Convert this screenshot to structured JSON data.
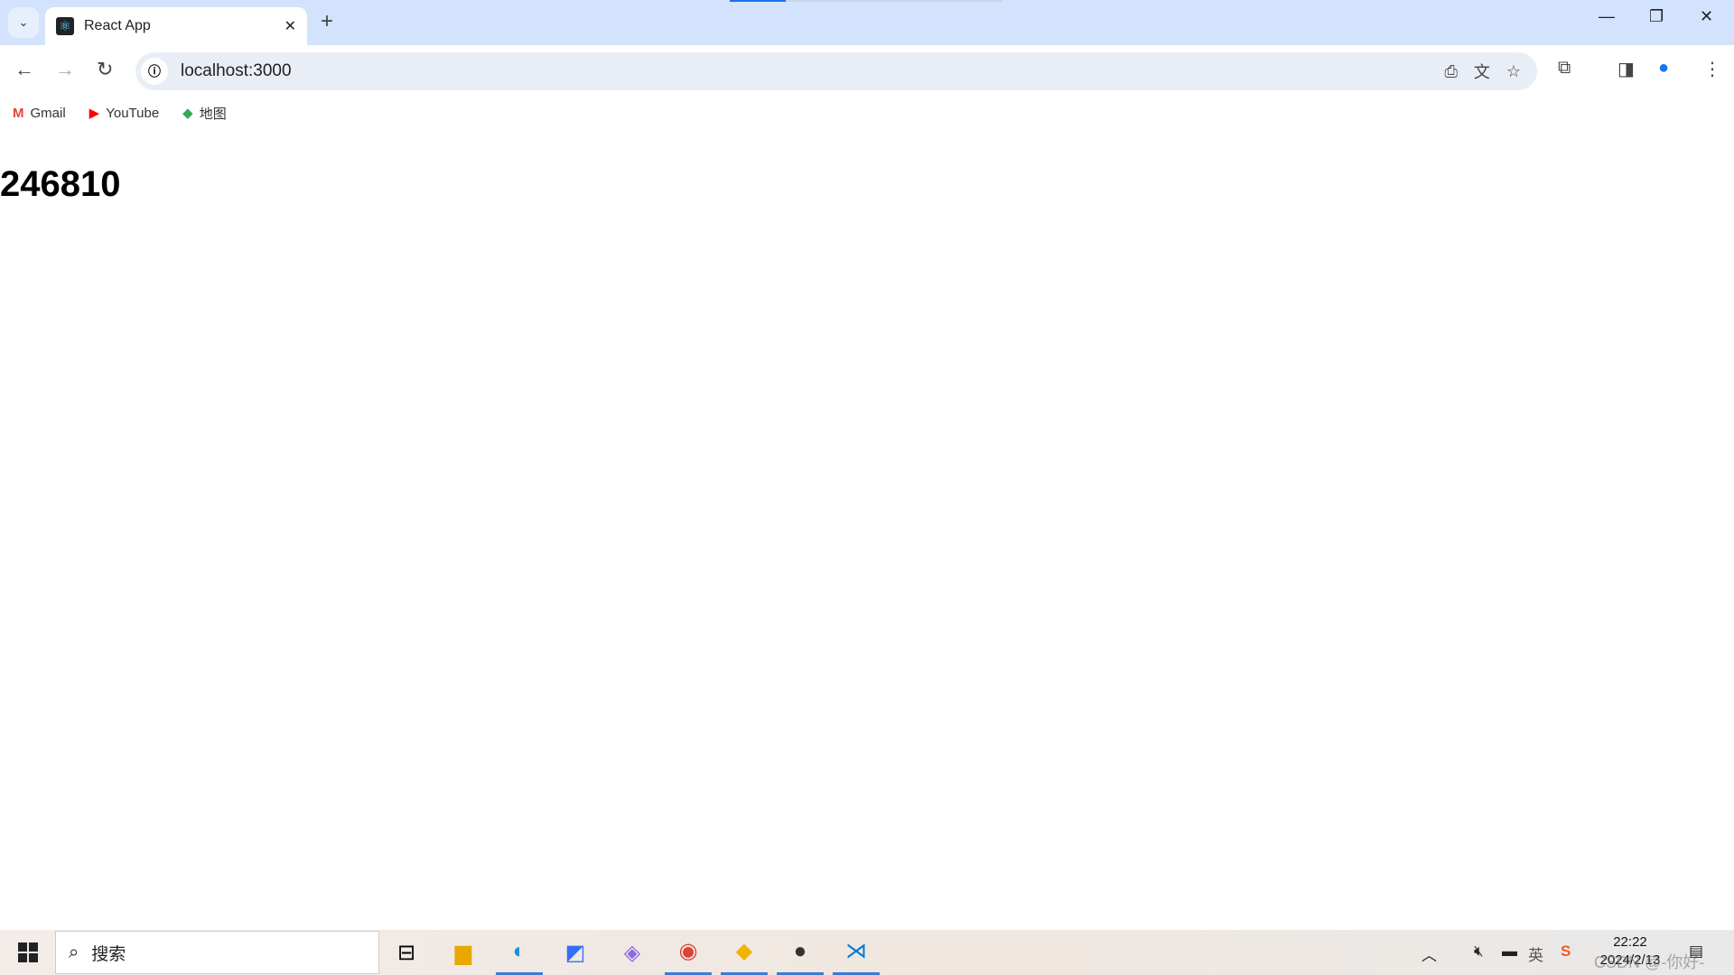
{
  "browser": {
    "tab": {
      "title": "React App",
      "favicon": "react-logo-icon"
    },
    "address": "localhost:3000",
    "bookmarks": [
      {
        "label": "Gmail",
        "icon": "gmail-icon"
      },
      {
        "label": "YouTube",
        "icon": "youtube-icon"
      },
      {
        "label": "地图",
        "icon": "maps-icon"
      }
    ]
  },
  "page": {
    "heading": "246810"
  },
  "taskbar": {
    "search_placeholder": "搜索",
    "apps": [
      "task-view",
      "file-explorer",
      "edge",
      "feishu",
      "copilot",
      "chrome",
      "sunlogin",
      "avatar-app",
      "vscode"
    ],
    "tray": {
      "ime": "英",
      "time": "22:22",
      "date": "2024/2/13"
    },
    "watermark": "CSDN @-你好-"
  },
  "colors": {
    "tabstrip": "#d3e3fd",
    "omnibox": "#e9eef6",
    "accent": "#1a73e8"
  }
}
